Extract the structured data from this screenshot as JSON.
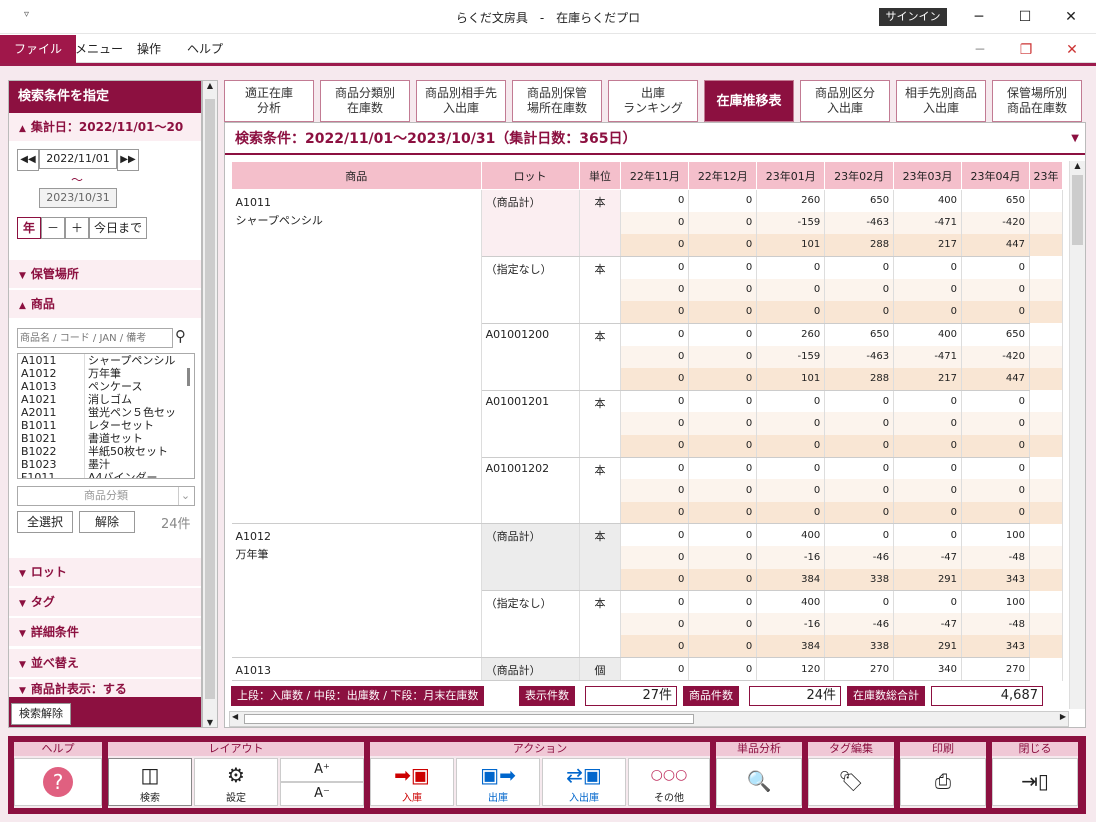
{
  "window": {
    "title": "らくだ文房具　-　在庫らくだプロ",
    "signin": "サインイン",
    "qa": "▿"
  },
  "menus": [
    "ファイル",
    "メニュー",
    "操作",
    "ヘルプ"
  ],
  "sidebar": {
    "header": "検索条件を指定",
    "period_label": "集計日：2022/11/01〜20",
    "date_from": "2022/11/01",
    "tilde": "〜",
    "date_to": "2023/10/31",
    "btn_year": "年",
    "btn_minus": "－",
    "btn_plus": "＋",
    "btn_today": "今日まで",
    "sec_location": "保管場所",
    "sec_product": "商品",
    "search_placeholder": "商品名 / コード / JAN / 備考",
    "products": [
      {
        "code": "A1011",
        "name": "シャープペンシル"
      },
      {
        "code": "A1012",
        "name": "万年筆"
      },
      {
        "code": "A1013",
        "name": "ペンケース"
      },
      {
        "code": "A1021",
        "name": "消しゴム"
      },
      {
        "code": "A2011",
        "name": "蛍光ペン５色セッ"
      },
      {
        "code": "B1011",
        "name": "レターセット"
      },
      {
        "code": "B1021",
        "name": "書道セット"
      },
      {
        "code": "B1022",
        "name": "半紙50枚セット"
      },
      {
        "code": "B1023",
        "name": "墨汁"
      },
      {
        "code": "F1011",
        "name": "A4バインダー"
      }
    ],
    "category_placeholder": "商品分類",
    "btn_select_all": "全選択",
    "btn_clear": "解除",
    "count": "24件",
    "sec_lot": "ロット",
    "sec_tag": "タグ",
    "sec_detail": "詳細条件",
    "sec_sort": "並べ替え",
    "sec_total": "商品計表示：する",
    "btn_reset": "検索解除"
  },
  "tabs": [
    {
      "label": "適正在庫\n分析"
    },
    {
      "label": "商品分類別\n在庫数"
    },
    {
      "label": "商品別相手先\n入出庫"
    },
    {
      "label": "商品別保管\n場所在庫数"
    },
    {
      "label": "出庫\nランキング"
    },
    {
      "label": "在庫推移表"
    },
    {
      "label": "商品別区分\n入出庫"
    },
    {
      "label": "相手先別商品\n入出庫"
    },
    {
      "label": "保管場所別\n商品在庫数"
    }
  ],
  "condition": "検索条件：2022/11/01〜2023/10/31（集計日数：365日）",
  "table": {
    "headers": [
      "商品",
      "ロット",
      "単位",
      "22年11月",
      "22年12月",
      "23年01月",
      "23年02月",
      "23年03月",
      "23年04月",
      "23年"
    ],
    "rows": [
      {
        "code": "A1011",
        "name": "シャープペンシル",
        "lot": "（商品計）",
        "unit": "本",
        "kind": "pink",
        "data": [
          [
            "0",
            "0",
            "260",
            "650",
            "400",
            "650"
          ],
          [
            "0",
            "0",
            "-159",
            "-463",
            "-471",
            "-420"
          ],
          [
            "0",
            "0",
            "101",
            "288",
            "217",
            "447"
          ]
        ]
      },
      {
        "code": "",
        "name": "",
        "lot": "（指定なし）",
        "unit": "本",
        "kind": "",
        "data": [
          [
            "0",
            "0",
            "0",
            "0",
            "0",
            "0"
          ],
          [
            "0",
            "0",
            "0",
            "0",
            "0",
            "0"
          ],
          [
            "0",
            "0",
            "0",
            "0",
            "0",
            "0"
          ]
        ]
      },
      {
        "code": "",
        "name": "",
        "lot": "A01001200",
        "unit": "本",
        "kind": "",
        "data": [
          [
            "0",
            "0",
            "260",
            "650",
            "400",
            "650"
          ],
          [
            "0",
            "0",
            "-159",
            "-463",
            "-471",
            "-420"
          ],
          [
            "0",
            "0",
            "101",
            "288",
            "217",
            "447"
          ]
        ]
      },
      {
        "code": "",
        "name": "",
        "lot": "A01001201",
        "unit": "本",
        "kind": "",
        "data": [
          [
            "0",
            "0",
            "0",
            "0",
            "0",
            "0"
          ],
          [
            "0",
            "0",
            "0",
            "0",
            "0",
            "0"
          ],
          [
            "0",
            "0",
            "0",
            "0",
            "0",
            "0"
          ]
        ]
      },
      {
        "code": "",
        "name": "",
        "lot": "A01001202",
        "unit": "本",
        "kind": "",
        "data": [
          [
            "0",
            "0",
            "0",
            "0",
            "0",
            "0"
          ],
          [
            "0",
            "0",
            "0",
            "0",
            "0",
            "0"
          ],
          [
            "0",
            "0",
            "0",
            "0",
            "0",
            "0"
          ]
        ]
      },
      {
        "code": "A1012",
        "name": "万年筆",
        "lot": "（商品計）",
        "unit": "本",
        "kind": "grey",
        "data": [
          [
            "0",
            "0",
            "400",
            "0",
            "0",
            "100"
          ],
          [
            "0",
            "0",
            "-16",
            "-46",
            "-47",
            "-48"
          ],
          [
            "0",
            "0",
            "384",
            "338",
            "291",
            "343"
          ]
        ]
      },
      {
        "code": "",
        "name": "",
        "lot": "（指定なし）",
        "unit": "本",
        "kind": "",
        "data": [
          [
            "0",
            "0",
            "400",
            "0",
            "0",
            "100"
          ],
          [
            "0",
            "0",
            "-16",
            "-46",
            "-47",
            "-48"
          ],
          [
            "0",
            "0",
            "384",
            "338",
            "291",
            "343"
          ]
        ]
      },
      {
        "code": "A1013",
        "name": "",
        "lot": "（商品計）",
        "unit": "個",
        "kind": "grey",
        "data": [
          [
            "0",
            "0",
            "120",
            "270",
            "340",
            "270"
          ]
        ]
      }
    ]
  },
  "summary": {
    "legend": "上段：入庫数 / 中段：出庫数 / 下段：月末在庫数",
    "count_label": "表示件数",
    "count_value": "27件",
    "items_label": "商品件数",
    "items_value": "24件",
    "total_label": "在庫数総合計",
    "total_value": "4,687"
  },
  "footer": {
    "g_help": "ヘルプ",
    "g_layout": "レイアウト",
    "g_action": "アクション",
    "g_single": "単品分析",
    "g_tag": "タグ編集",
    "g_print": "印刷",
    "g_close": "閉じる",
    "b_search": "検索",
    "b_settings": "設定",
    "b_in": "入庫",
    "b_out": "出庫",
    "b_inout": "入出庫",
    "b_other": "その他"
  }
}
